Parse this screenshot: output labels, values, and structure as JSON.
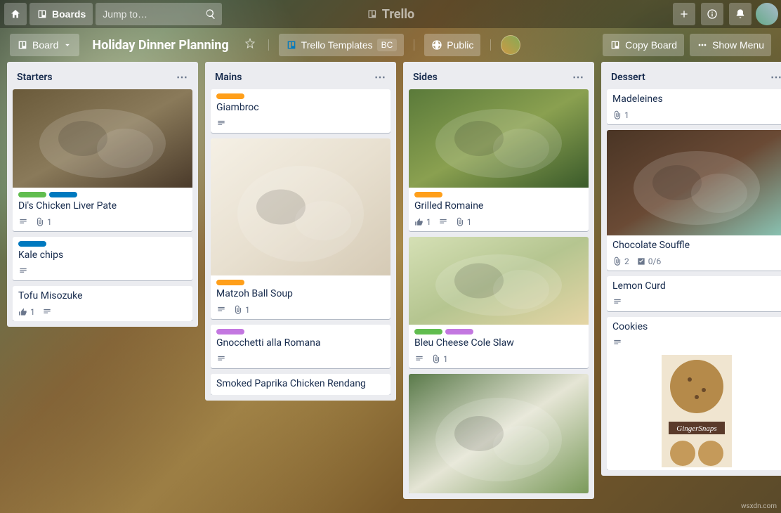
{
  "header": {
    "boards_label": "Boards",
    "search_placeholder": "Jump to…",
    "brand": "Trello"
  },
  "subheader": {
    "board_view_label": "Board",
    "board_title": "Holiday Dinner Planning",
    "templates_label": "Trello Templates",
    "templates_badge": "BC",
    "visibility_label": "Public",
    "copy_board_label": "Copy Board",
    "show_menu_label": "Show Menu"
  },
  "lists": [
    {
      "title": "Starters",
      "cards": [
        {
          "title": "Di's Chicken Liver Pate",
          "labels": [
            "green",
            "blue"
          ],
          "desc": true,
          "attach": "1",
          "cover": "pate"
        },
        {
          "title": "Kale chips",
          "labels": [
            "blue"
          ],
          "desc": true
        },
        {
          "title": "Tofu Misozuke",
          "vote": "1",
          "desc": true
        }
      ]
    },
    {
      "title": "Mains",
      "cards": [
        {
          "title": "Giambroc",
          "labels": [
            "orange"
          ],
          "desc": true
        },
        {
          "title": "Matzoh Ball Soup",
          "labels": [
            "orange"
          ],
          "desc": true,
          "attach": "1",
          "cover": "soup"
        },
        {
          "title": "Gnocchetti alla Romana",
          "labels": [
            "purple"
          ],
          "desc": true
        },
        {
          "title": "Smoked Paprika Chicken Rendang"
        }
      ]
    },
    {
      "title": "Sides",
      "cards": [
        {
          "title": "Grilled Romaine",
          "labels": [
            "orange"
          ],
          "vote": "1",
          "desc": true,
          "attach": "1",
          "cover": "romaine"
        },
        {
          "title": "Bleu Cheese Cole Slaw",
          "labels": [
            "green",
            "purple"
          ],
          "desc": true,
          "attach": "1",
          "cover": "slaw"
        },
        {
          "title": "",
          "cover": "peppers",
          "partial": true
        }
      ]
    },
    {
      "title": "Dessert",
      "cards": [
        {
          "title": "Madeleines",
          "attach": "1"
        },
        {
          "title": "Chocolate Souffle",
          "attach": "2",
          "check": "0/6",
          "cover": "souffle"
        },
        {
          "title": "Lemon Curd",
          "desc": true
        },
        {
          "title": "Cookies",
          "desc": true,
          "bottom_cover": "GingerSnaps"
        }
      ]
    }
  ],
  "watermark": "wsxdn.com"
}
